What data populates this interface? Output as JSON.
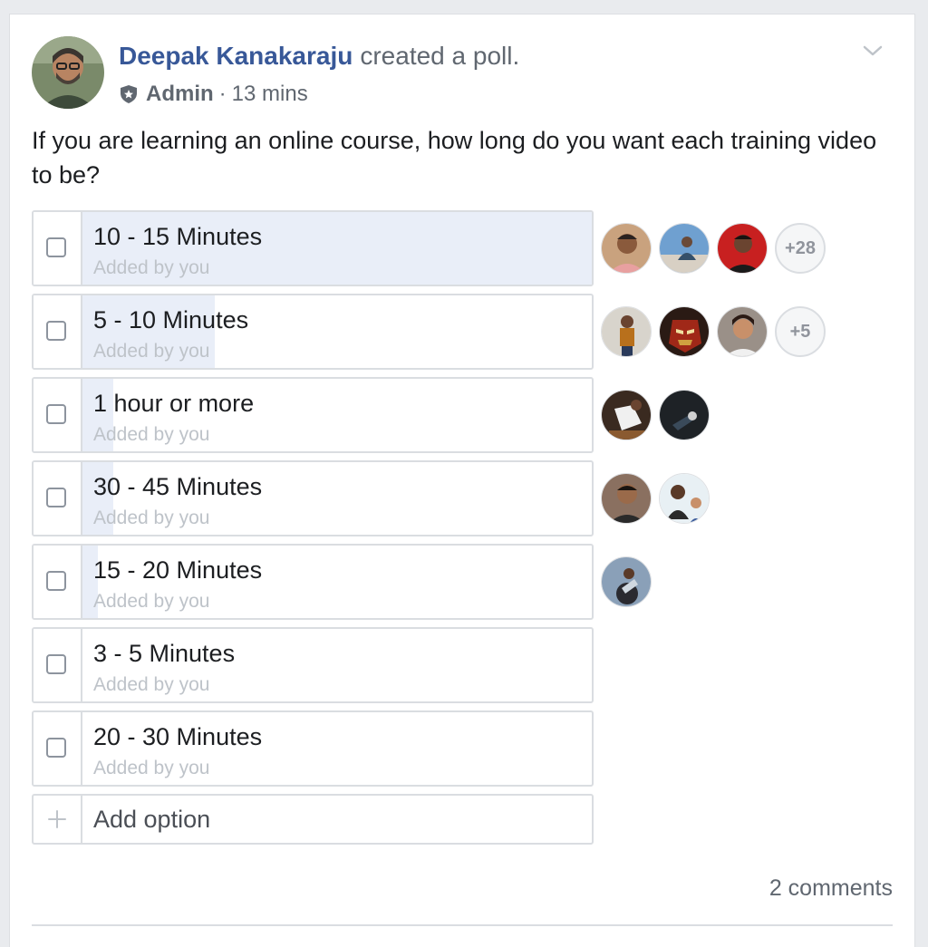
{
  "post": {
    "author_name": "Deepak Kanakaraju",
    "action_text": "created a poll.",
    "role_icon": "admin-shield-icon",
    "role": "Admin",
    "separator": "·",
    "time": "13 mins",
    "question": "If you are learning an online course, how long do you want each training video to be?"
  },
  "poll": {
    "options": [
      {
        "label": "10 - 15 Minutes",
        "sub": "Added by you",
        "fill_fraction": 1.0,
        "more": "+28"
      },
      {
        "label": "5 - 10 Minutes",
        "sub": "Added by you",
        "fill_fraction": 0.26,
        "more": "+5"
      },
      {
        "label": "1 hour or more",
        "sub": "Added by you",
        "fill_fraction": 0.06,
        "more": ""
      },
      {
        "label": "30 - 45 Minutes",
        "sub": "Added by you",
        "fill_fraction": 0.06,
        "more": ""
      },
      {
        "label": "15 - 20 Minutes",
        "sub": "Added by you",
        "fill_fraction": 0.03,
        "more": ""
      },
      {
        "label": "3 - 5 Minutes",
        "sub": "Added by you",
        "fill_fraction": 0,
        "more": ""
      },
      {
        "label": "20 - 30 Minutes",
        "sub": "Added by you",
        "fill_fraction": 0,
        "more": ""
      }
    ],
    "add_option_label": "Add option",
    "add_option_icon": "plus-icon"
  },
  "footer": {
    "comments": "2 comments"
  },
  "colors": {
    "author_link": "#385898",
    "meta_text": "#606770",
    "fill": "#e9eef8",
    "border": "#dadde1"
  }
}
